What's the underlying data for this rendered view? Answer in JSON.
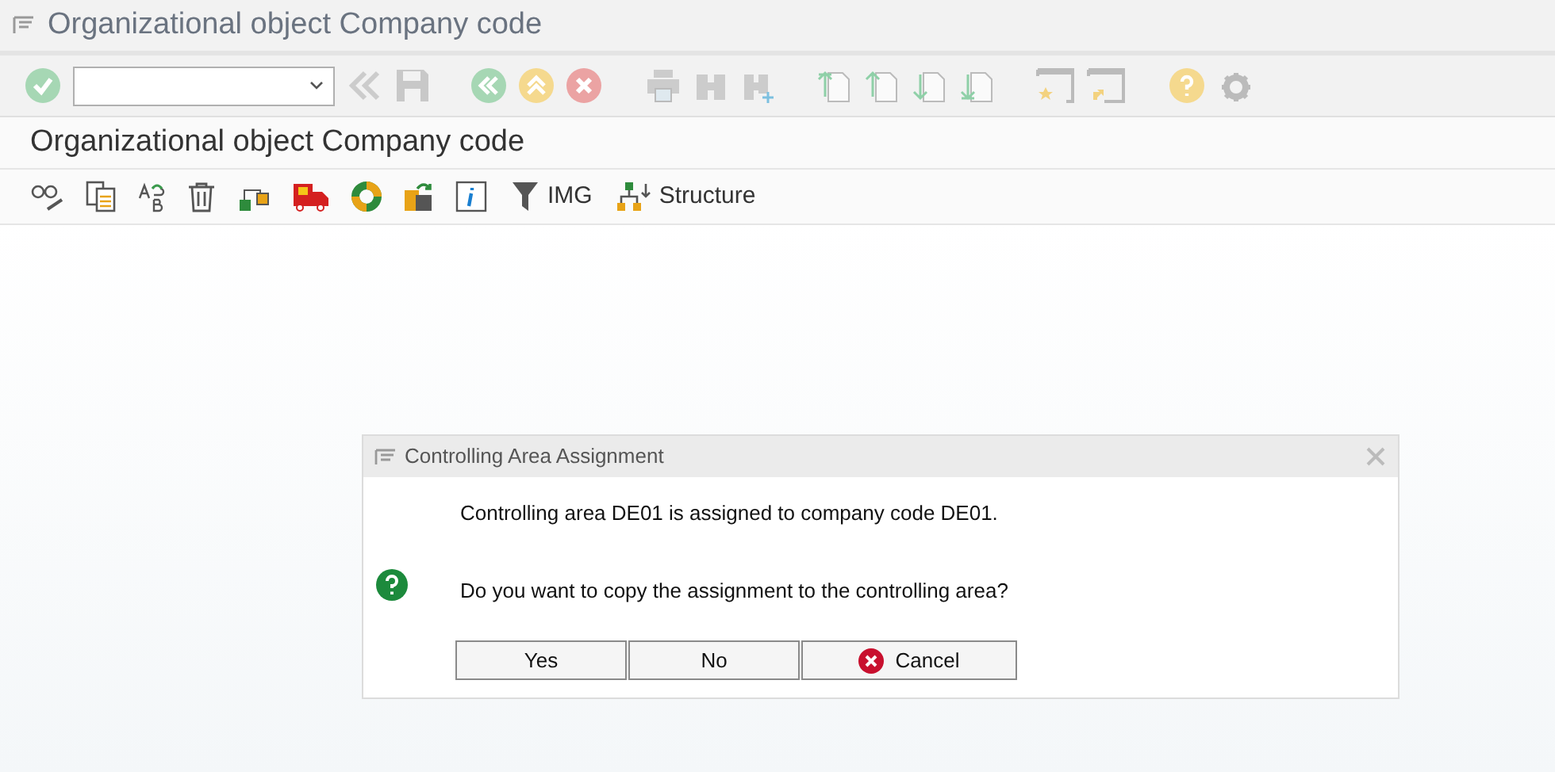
{
  "window": {
    "title": "Organizational object Company code"
  },
  "page_title": "Organizational object Company code",
  "app_toolbar": [
    {
      "kind": "icon"
    },
    {
      "kind": "img",
      "label": "IMG"
    },
    {
      "kind": "structure",
      "label": "Structure"
    }
  ],
  "dialog": {
    "title": "Controlling Area Assignment",
    "messages": [
      "Controlling area DE01 is assigned to company code DE01.",
      "Do you want to copy the assignment to the controlling area?"
    ],
    "buttons": [
      {
        "label": "Yes",
        "kind": "plain"
      },
      {
        "label": "No",
        "kind": "plain"
      },
      {
        "label": "Cancel",
        "kind": "cancel"
      }
    ]
  }
}
